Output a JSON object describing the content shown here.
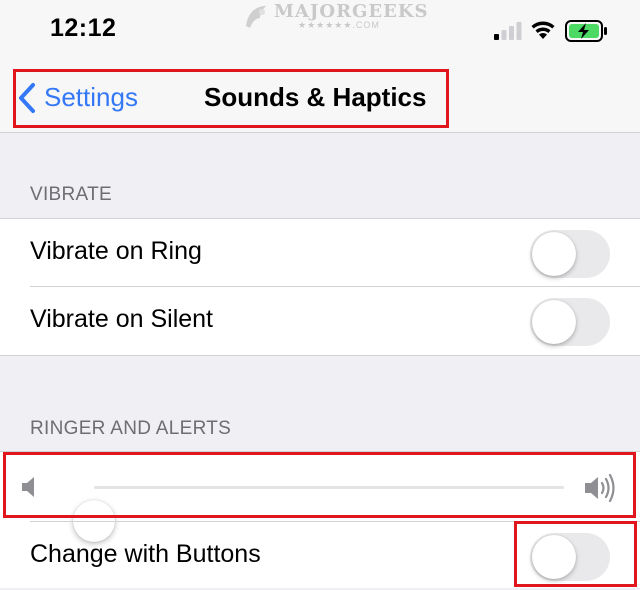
{
  "status_bar": {
    "time": "12:12",
    "watermark": "MAJORGEEKS",
    "watermark_sub": "★★★★★★.COM",
    "icons": [
      "signal-icon",
      "wifi-icon",
      "battery-charging-icon"
    ]
  },
  "nav": {
    "back_label": "Settings",
    "title": "Sounds & Haptics"
  },
  "vibrate": {
    "header": "VIBRATE",
    "items": [
      {
        "label": "Vibrate on Ring",
        "on": false
      },
      {
        "label": "Vibrate on Silent",
        "on": false
      }
    ]
  },
  "ringer": {
    "header": "RINGER AND ALERTS",
    "volume_fraction": 0.0,
    "change_with_buttons": {
      "label": "Change with Buttons",
      "on": false
    }
  },
  "colors": {
    "accent": "#3478f6",
    "highlight": "#e0161c",
    "toggle_off": "#e9e9eb",
    "background": "#efeff4"
  }
}
